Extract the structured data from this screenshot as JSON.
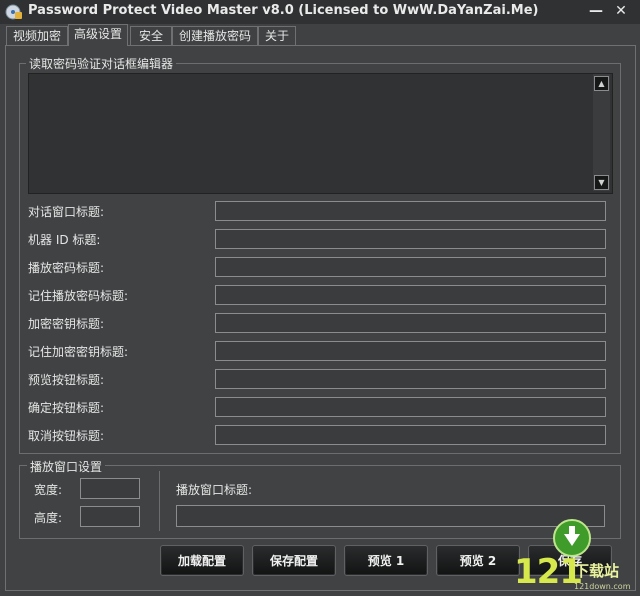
{
  "window": {
    "title": "Password Protect Video Master v8.0 (Licensed to WwW.DaYanZai.Me)",
    "minimize_glyph": "—",
    "close_glyph": "✕"
  },
  "tabs": [
    {
      "label": "视频加密"
    },
    {
      "label": "高级设置",
      "active": true
    },
    {
      "label": "安全"
    },
    {
      "label": "创建播放密码"
    },
    {
      "label": "关于"
    }
  ],
  "editor_group": {
    "label": "读取密码验证对话框编辑器",
    "content": ""
  },
  "fields": [
    {
      "label": "对话窗口标题:",
      "value": ""
    },
    {
      "label": "机器 ID 标题:",
      "value": ""
    },
    {
      "label": "播放密码标题:",
      "value": ""
    },
    {
      "label": "记住播放密码标题:",
      "value": ""
    },
    {
      "label": "加密密钥标题:",
      "value": ""
    },
    {
      "label": "记住加密密钥标题:",
      "value": ""
    },
    {
      "label": "预览按钮标题:",
      "value": ""
    },
    {
      "label": "确定按钮标题:",
      "value": ""
    },
    {
      "label": "取消按钮标题:",
      "value": ""
    }
  ],
  "play_window": {
    "label": "播放窗口设置",
    "width_label": "宽度:",
    "width_value": "",
    "height_label": "高度:",
    "height_value": "",
    "title_label": "播放窗口标题:",
    "title_value": ""
  },
  "buttons": {
    "load": "加载配置",
    "save": "保存配置",
    "preview1": "预览 1",
    "preview2": "预览 2",
    "save_partial": "保存"
  },
  "watermark": {
    "brand": "121",
    "tag": "下载站",
    "url": "121down.com"
  },
  "icons": {
    "app": "lock-disc-icon",
    "scroll_up": "▲",
    "scroll_down": "▼"
  }
}
